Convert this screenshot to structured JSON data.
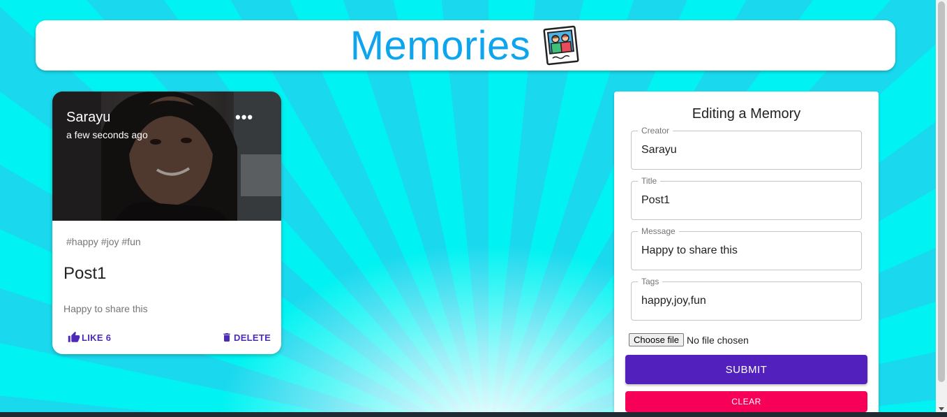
{
  "header": {
    "title": "Memories",
    "logo_icon": "photo-memories-icon"
  },
  "post": {
    "creator": "Sarayu",
    "time": "a few seconds ago",
    "more_icon": "more-horizontal-icon",
    "tags": "#happy #joy #fun",
    "title": "Post1",
    "message": "Happy to share this",
    "like_label": "LIKE 6",
    "like_icon": "thumb-up-icon",
    "delete_label": "DELETE",
    "delete_icon": "trash-icon"
  },
  "form": {
    "heading": "Editing a Memory",
    "creator": {
      "label": "Creator",
      "value": "Sarayu"
    },
    "title": {
      "label": "Title",
      "value": "Post1"
    },
    "message": {
      "label": "Message",
      "value": "Happy to share this"
    },
    "tags": {
      "label": "Tags",
      "value": "happy,joy,fun"
    },
    "file_button": "Choose file",
    "file_status": "No file chosen",
    "submit_label": "SUBMIT",
    "clear_label": "CLEAR"
  },
  "colors": {
    "background": "#00f6f6",
    "accent_blue": "#0ea5ee",
    "primary": "#5221bd",
    "secondary": "#f70057"
  }
}
